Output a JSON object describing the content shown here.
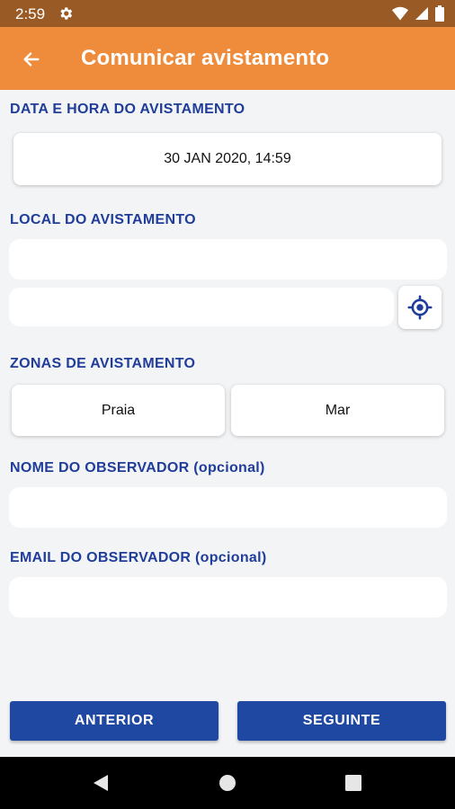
{
  "status_bar": {
    "time": "2:59"
  },
  "app_bar": {
    "title": "Comunicar avistamento"
  },
  "datetime": {
    "label": "DATA E HORA DO AVISTAMENTO",
    "value": "30 JAN 2020, 14:59"
  },
  "location": {
    "label": "LOCAL DO AVISTAMENTO",
    "field1_value": "",
    "field2_value": ""
  },
  "zones": {
    "label": "ZONAS DE AVISTAMENTO",
    "options": [
      "Praia",
      "Mar"
    ]
  },
  "observer_name": {
    "label": "NOME DO OBSERVADOR (opcional)",
    "value": ""
  },
  "observer_email": {
    "label": "EMAIL DO OBSERVADOR (opcional)",
    "value": ""
  },
  "buttons": {
    "previous": "ANTERIOR",
    "next": "SEGUINTE"
  },
  "colors": {
    "app_bar": "#ef8c3b",
    "status_bar": "#9a5a26",
    "accent": "#1f3d99",
    "button": "#1f48a3"
  },
  "icons": {
    "back": "arrow-left-icon",
    "settings": "gear-icon",
    "locate": "crosshair-icon"
  }
}
